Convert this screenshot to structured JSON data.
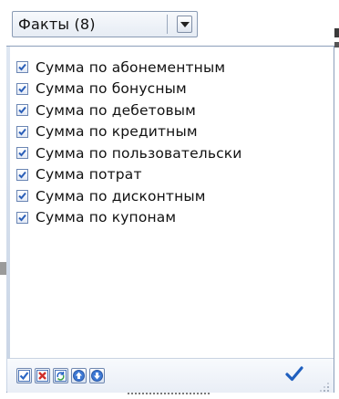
{
  "header": {
    "title": "Факты (8)",
    "dropdown_icon": "chevron-down-icon"
  },
  "list": {
    "items": [
      {
        "label": "Сумма по абонементным",
        "checked": true
      },
      {
        "label": "Сумма по бонусным",
        "checked": true
      },
      {
        "label": "Сумма по дебетовым",
        "checked": true
      },
      {
        "label": "Сумма по кредитным",
        "checked": true
      },
      {
        "label": "Сумма по пользовательски",
        "checked": true
      },
      {
        "label": "Сумма потрат",
        "checked": true
      },
      {
        "label": "Сумма по дисконтным",
        "checked": true
      },
      {
        "label": "Сумма по купонам",
        "checked": true
      }
    ]
  },
  "toolbar": {
    "buttons": [
      {
        "icon": "check-all-icon",
        "color": "#2b66c4"
      },
      {
        "icon": "uncheck-all-icon",
        "color": "#d0302a"
      },
      {
        "icon": "invert-selection-icon",
        "color": "#2b66c4"
      },
      {
        "icon": "move-up-icon",
        "color": "#2b66c4"
      },
      {
        "icon": "move-down-icon",
        "color": "#2b66c4"
      }
    ],
    "apply_icon": "apply-check-icon",
    "resize_icon": "resize-grip-icon"
  },
  "colors": {
    "accent": "#2b66c4",
    "border": "#8c9fbb",
    "danger": "#d0302a"
  }
}
